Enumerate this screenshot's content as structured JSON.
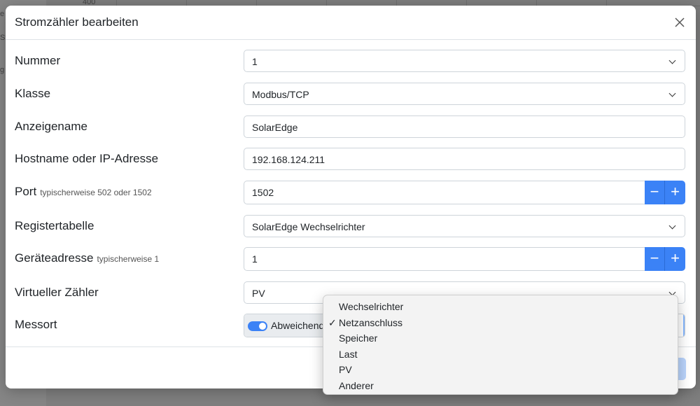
{
  "background": {
    "fragments": [
      "400",
      "e",
      "St",
      "g"
    ]
  },
  "modal": {
    "title": "Stromzähler bearbeiten",
    "close_icon": "close-icon"
  },
  "form": {
    "nummer": {
      "label": "Nummer",
      "value": "1"
    },
    "klasse": {
      "label": "Klasse",
      "value": "Modbus/TCP"
    },
    "anzeigename": {
      "label": "Anzeigename",
      "value": "SolarEdge"
    },
    "hostname": {
      "label": "Hostname oder IP-Adresse",
      "value": "192.168.124.211"
    },
    "port": {
      "label": "Port",
      "hint": "typischerweise 502 oder 1502",
      "value": "1502",
      "minus": "−",
      "plus": "+"
    },
    "registertabelle": {
      "label": "Registertabelle",
      "value": "SolarEdge Wechselrichter"
    },
    "geraeteadresse": {
      "label": "Geräteadresse",
      "hint": "typischerweise 1",
      "value": "1",
      "minus": "−",
      "plus": "+"
    },
    "virtueller_zaehler": {
      "label": "Virtueller Zähler",
      "value": "PV"
    },
    "messort": {
      "label": "Messort",
      "toggle_label": "Abweichend",
      "toggle_on": true
    }
  },
  "dropdown": {
    "selected": "Netzanschluss",
    "check_glyph": "✓",
    "options": [
      "Wechselrichter",
      "Netzanschluss",
      "Speicher",
      "Last",
      "PV",
      "Anderer"
    ]
  },
  "colors": {
    "accent": "#3b82f6",
    "border": "#ced4da"
  }
}
